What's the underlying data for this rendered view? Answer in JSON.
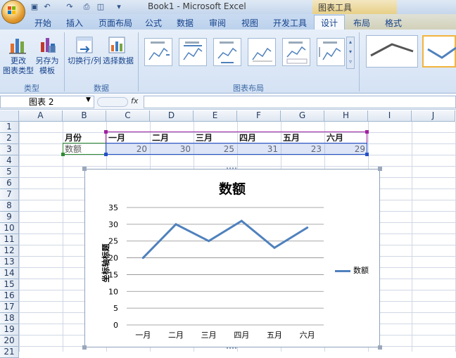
{
  "window": {
    "title": "Book1 - Microsoft Excel",
    "tools_label": "图表工具"
  },
  "tabs": [
    "开始",
    "插入",
    "页面布局",
    "公式",
    "数据",
    "审阅",
    "视图",
    "开发工具",
    "设计",
    "布局",
    "格式"
  ],
  "ribbon": {
    "groups": [
      {
        "label": "类型",
        "buttons": [
          "更改\n图表类型",
          "另存为\n模板"
        ]
      },
      {
        "label": "数据",
        "buttons": [
          "切换行/列",
          "选择数据"
        ]
      },
      {
        "label": "图表布局",
        "layouts": 6
      },
      {
        "label": "",
        "styles": 2
      }
    ]
  },
  "formula_bar": {
    "name_box": "图表 2",
    "fx": "fx",
    "formula": ""
  },
  "columns": [
    "A",
    "B",
    "C",
    "D",
    "E",
    "F",
    "G",
    "H",
    "I",
    "J"
  ],
  "rows": [
    "1",
    "2",
    "3",
    "4",
    "5",
    "6",
    "7",
    "8",
    "9",
    "10",
    "11",
    "12",
    "13",
    "14",
    "15",
    "16",
    "17",
    "18",
    "19",
    "20",
    "21"
  ],
  "sheet": {
    "header_row": {
      "label": "月份",
      "months": [
        "一月",
        "二月",
        "三月",
        "四月",
        "五月",
        "六月"
      ]
    },
    "value_row": {
      "label": "数额",
      "values": [
        "20",
        "30",
        "25",
        "31",
        "23",
        "29"
      ]
    }
  },
  "chart_data": {
    "type": "line",
    "title": "数额",
    "ylabel": "坐标轴标题",
    "xlabel": "",
    "categories": [
      "一月",
      "二月",
      "三月",
      "四月",
      "五月",
      "六月"
    ],
    "series": [
      {
        "name": "数额",
        "values": [
          20,
          30,
          25,
          31,
          23,
          29
        ]
      }
    ],
    "ylim": [
      0,
      35
    ],
    "yticks": [
      0,
      5,
      10,
      15,
      20,
      25,
      30,
      35
    ],
    "grid": true,
    "legend": "right",
    "colors": {
      "series": "#4f81bd",
      "grid": "#8c8c8c"
    }
  }
}
